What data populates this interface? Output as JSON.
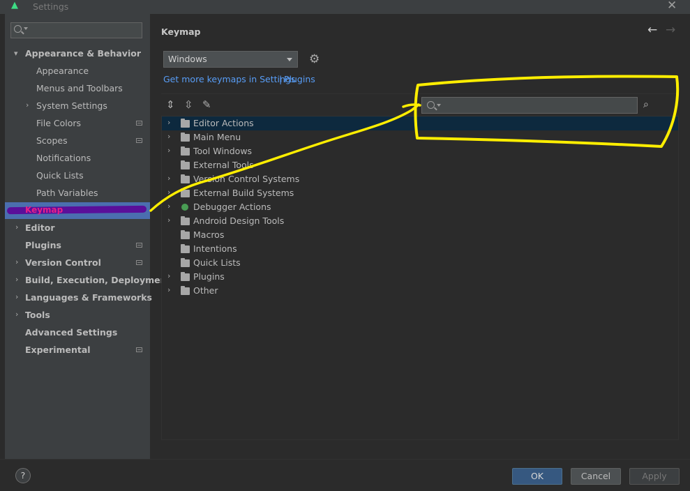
{
  "window": {
    "title": "Settings",
    "app_icon": "android-icon",
    "close_label": "✕"
  },
  "search": {
    "placeholder": ""
  },
  "sidebar": {
    "items": [
      {
        "label": "Appearance & Behavior"
      },
      {
        "label": "Appearance"
      },
      {
        "label": "Menus and Toolbars"
      },
      {
        "label": "System Settings"
      },
      {
        "label": "File Colors"
      },
      {
        "label": "Scopes"
      },
      {
        "label": "Notifications"
      },
      {
        "label": "Quick Lists"
      },
      {
        "label": "Path Variables"
      },
      {
        "label": "Keymap"
      },
      {
        "label": "Editor"
      },
      {
        "label": "Plugins"
      },
      {
        "label": "Version Control"
      },
      {
        "label": "Build, Execution, Deployment"
      },
      {
        "label": "Languages & Frameworks"
      },
      {
        "label": "Tools"
      },
      {
        "label": "Advanced Settings"
      },
      {
        "label": "Experimental"
      }
    ]
  },
  "main": {
    "title": "Keymap",
    "keymap_select": "Windows",
    "link_text": "Get more keymaps in Settings",
    "link_separator": "|",
    "link_plugins": "Plugins",
    "filter_placeholder": "",
    "tree": [
      {
        "label": "Editor Actions"
      },
      {
        "label": "Main Menu"
      },
      {
        "label": "Tool Windows"
      },
      {
        "label": "External Tools"
      },
      {
        "label": "Version Control Systems"
      },
      {
        "label": "External Build Systems"
      },
      {
        "label": "Debugger Actions"
      },
      {
        "label": "Android Design Tools"
      },
      {
        "label": "Macros"
      },
      {
        "label": "Intentions"
      },
      {
        "label": "Quick Lists"
      },
      {
        "label": "Plugins"
      },
      {
        "label": "Other"
      }
    ]
  },
  "footer": {
    "help": "?",
    "ok": "OK",
    "cancel": "Cancel",
    "apply": "Apply"
  },
  "colors": {
    "accent": "#4b6eaf",
    "selection": "#0d293e",
    "link": "#589df6",
    "annotation": "#ffee00"
  }
}
